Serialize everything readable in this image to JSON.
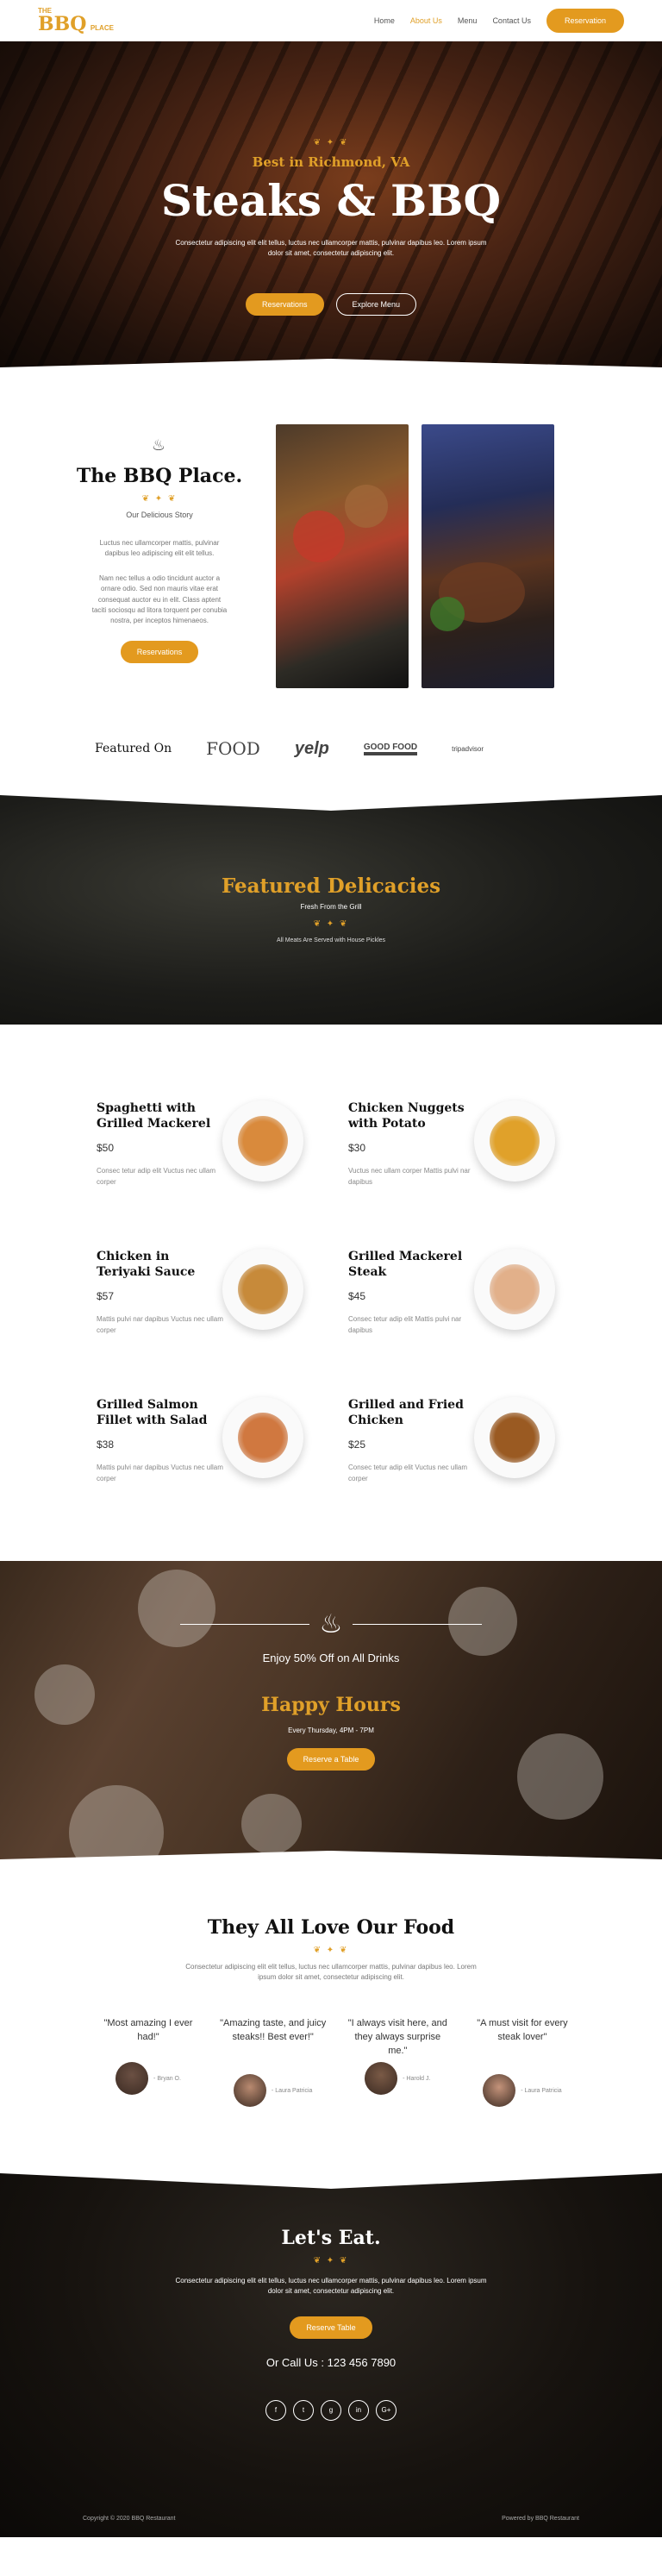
{
  "nav": {
    "logo_top": "THE",
    "logo_main": "BBQ",
    "logo_sub": "PLACE",
    "items": [
      "Home",
      "About Us",
      "Menu",
      "Contact Us"
    ],
    "active_index": 1,
    "cta": "Reservation"
  },
  "hero": {
    "kicker": "Best in Richmond, VA",
    "title": "Steaks & BBQ",
    "text": "Consectetur adipiscing elit elit tellus, luctus nec ullamcorper mattis, pulvinar dapibus leo. Lorem ipsum dolor sit amet, consectetur adipiscing elit.",
    "btn_primary": "Reservations",
    "btn_secondary": "Explore Menu"
  },
  "about": {
    "title": "The BBQ Place.",
    "subtitle": "Our Delicious Story",
    "p1": "Luctus nec ullamcorper mattis, pulvinar dapibus leo adipiscing elit elit tellus.",
    "p2": "Nam nec tellus a odio tincidunt auctor a ornare odio. Sed non mauris vitae erat consequat auctor eu in elit. Class aptent taciti sociosqu ad litora torquent per conubia nostra, per inceptos himenaeos.",
    "button": "Reservations"
  },
  "featured": {
    "label": "Featured On",
    "logos": [
      "FOOD",
      "yelp",
      "GOOD FOOD",
      "tripadvisor"
    ]
  },
  "delicacies": {
    "title": "Featured Delicacies",
    "subtitle": "Fresh From the Grill",
    "note": "All Meats Are Served with House Pickles"
  },
  "menu": [
    {
      "name": "Spaghetti with Grilled Mackerel",
      "price": "$50",
      "desc": "Consec tetur adip elit Vuctus nec ullam corper",
      "color": "#d98a3c"
    },
    {
      "name": "Chicken Nuggets with Potato",
      "price": "$30",
      "desc": "Vuctus nec ullam corper Mattis pulvi nar dapibus",
      "color": "#e0a12a"
    },
    {
      "name": "Chicken in Teriyaki Sauce",
      "price": "$57",
      "desc": "Mattis pulvi nar dapibus Vuctus nec ullam corper",
      "color": "#c78a3a"
    },
    {
      "name": "Grilled Mackerel Steak",
      "price": "$45",
      "desc": "Consec tetur adip elit Mattis pulvi nar dapibus",
      "color": "#e2b08a"
    },
    {
      "name": "Grilled Salmon Fillet with Salad",
      "price": "$38",
      "desc": "Mattis pulvi nar dapibus Vuctus nec ullam corper",
      "color": "#d07840"
    },
    {
      "name": "Grilled and Fried Chicken",
      "price": "$25",
      "desc": "Consec tetur adip elit Vuctus nec ullam corper",
      "color": "#9a5a22"
    }
  ],
  "happy": {
    "offer": "Enjoy 50% Off on All Drinks",
    "title": "Happy Hours",
    "time": "Every Thursday, 4PM - 7PM",
    "button": "Reserve a Table"
  },
  "testimonials": {
    "title": "They All Love Our Food",
    "lead": "Consectetur adipiscing elit elit tellus, luctus nec ullamcorper mattis, pulvinar dapibus leo. Lorem ipsum dolor sit amet, consectetur adipiscing elit.",
    "items": [
      {
        "quote": "\"Most amazing I ever had!\"",
        "name": "- Bryan O.",
        "color": "#6b5043"
      },
      {
        "quote": "\"Amazing taste, and juicy steaks!! Best ever!\"",
        "name": "- Laura Patricia",
        "color": "#b98a70"
      },
      {
        "quote": "\"I always visit here, and they always surprise me.\"",
        "name": "- Harold J.",
        "color": "#7a5a46"
      },
      {
        "quote": "\"A must visit for every steak lover\"",
        "name": "- Laura Patricia",
        "color": "#c4937a"
      }
    ]
  },
  "cta": {
    "title": "Let's Eat.",
    "text": "Consectetur adipiscing elit elit tellus, luctus nec ullamcorper mattis, pulvinar dapibus leo. Lorem ipsum dolor sit amet, consectetur adipiscing elit.",
    "button": "Reserve Table",
    "call": "Or Call Us : 123 456 7890",
    "socials": [
      "f",
      "t",
      "g",
      "in",
      "G+"
    ]
  },
  "footer": {
    "left": "Copyright © 2020 BBQ Restaurant",
    "right": "Powered by BBQ Restaurant"
  },
  "colors": {
    "accent": "#e0a029"
  }
}
